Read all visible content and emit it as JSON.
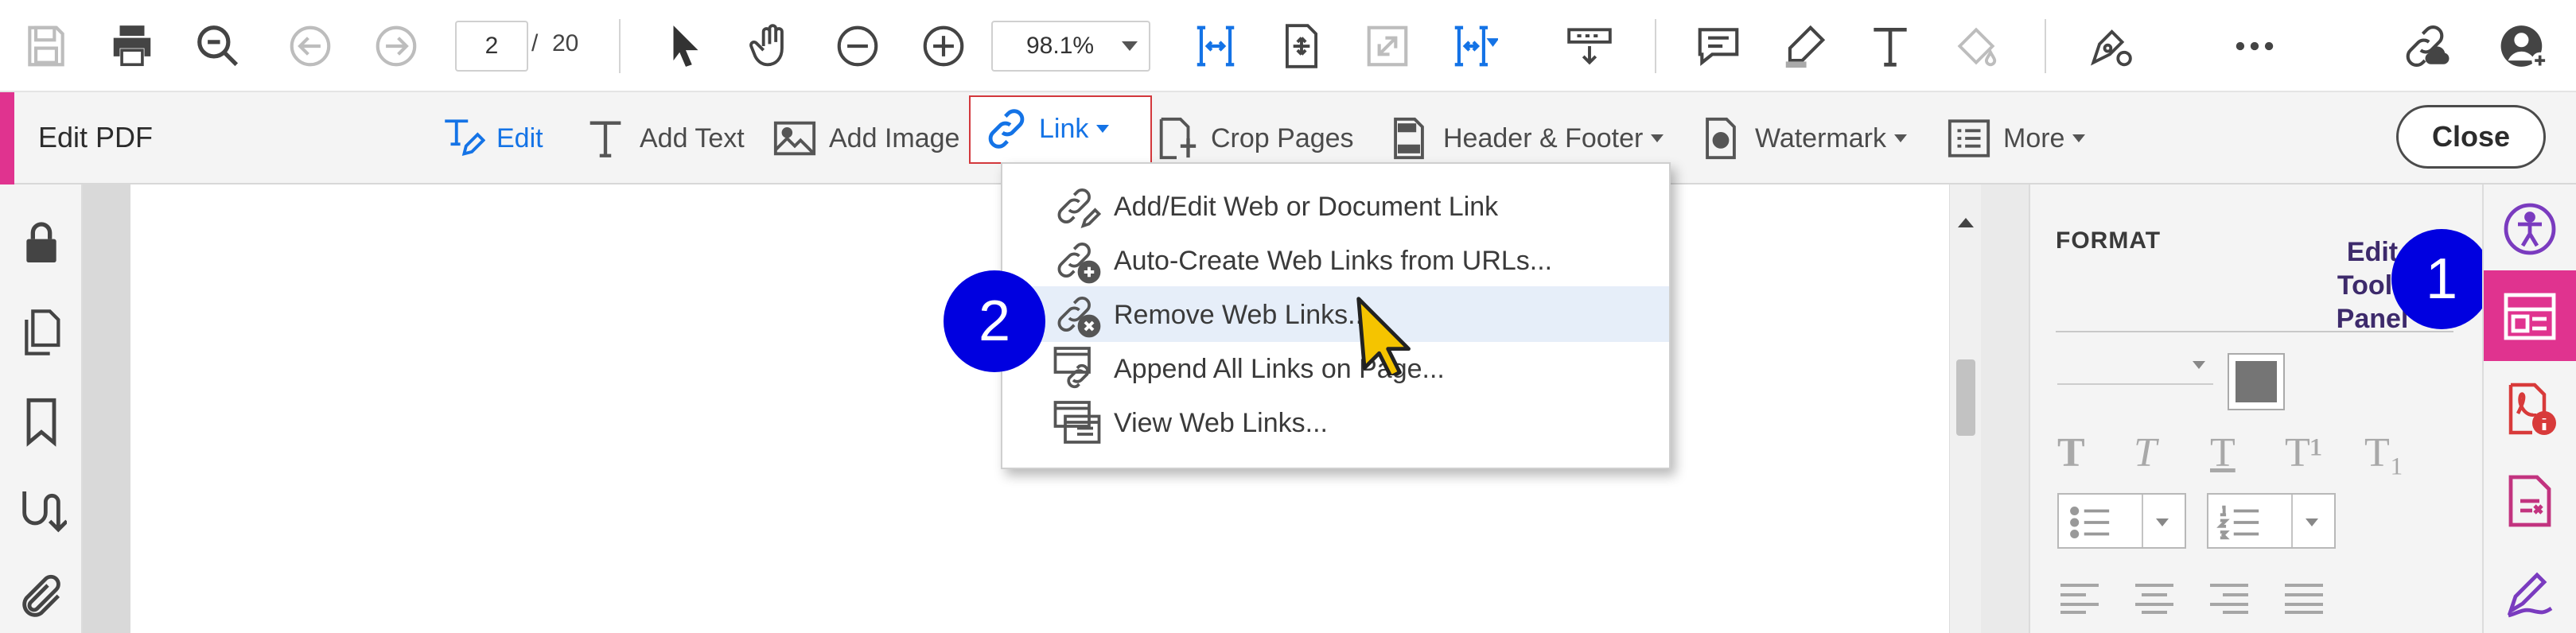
{
  "toolbar": {
    "icons": [
      "save-icon",
      "print-icon",
      "search-zoom-icon",
      "previous-page-icon",
      "next-page-icon",
      "select-arrow-icon",
      "hand-icon",
      "zoom-out-icon",
      "zoom-in-icon",
      "fit-width-icon",
      "fit-page-icon",
      "full-screen-icon",
      "scrolling-mode-icon",
      "rotate-view-icon",
      "comment-icon",
      "highlight-icon",
      "add-text-icon",
      "fill-sign-icon",
      "sign-icon",
      "more-tools-icon",
      "share-link-icon",
      "account-icon"
    ],
    "page_current": "2",
    "page_separator": "/",
    "page_total": "20",
    "zoom": "98.1%"
  },
  "editbar": {
    "title": "Edit PDF",
    "edit": "Edit",
    "add_text": "Add Text",
    "add_image": "Add Image",
    "link": "Link",
    "crop_pages": "Crop Pages",
    "header_footer": "Header & Footer",
    "watermark": "Watermark",
    "more": "More",
    "close": "Close"
  },
  "link_menu": {
    "items": [
      {
        "label": "Add/Edit Web or Document Link",
        "icon": "link-edit-icon"
      },
      {
        "label": "Auto-Create Web Links from URLs...",
        "icon": "link-add-icon"
      },
      {
        "label": "Remove Web Links...",
        "icon": "link-remove-icon",
        "hover": true
      },
      {
        "label": "Append All Links on Page...",
        "icon": "link-append-icon"
      },
      {
        "label": "View Web Links...",
        "icon": "view-links-icon"
      }
    ]
  },
  "callouts": {
    "one": "1",
    "two": "2"
  },
  "right_panel": {
    "format_label": "FORMAT",
    "panel_title_line1": "Edit",
    "panel_title_line2": "Tools",
    "panel_title_line3": "Panel",
    "text_styles": [
      "T",
      "T",
      "T",
      "T¹",
      "T₁"
    ]
  },
  "colors": {
    "accent_pink": "#e0338f",
    "link_blue": "#1473e6",
    "callout_blue": "#0000e0",
    "highlight_red": "#d3383c"
  }
}
